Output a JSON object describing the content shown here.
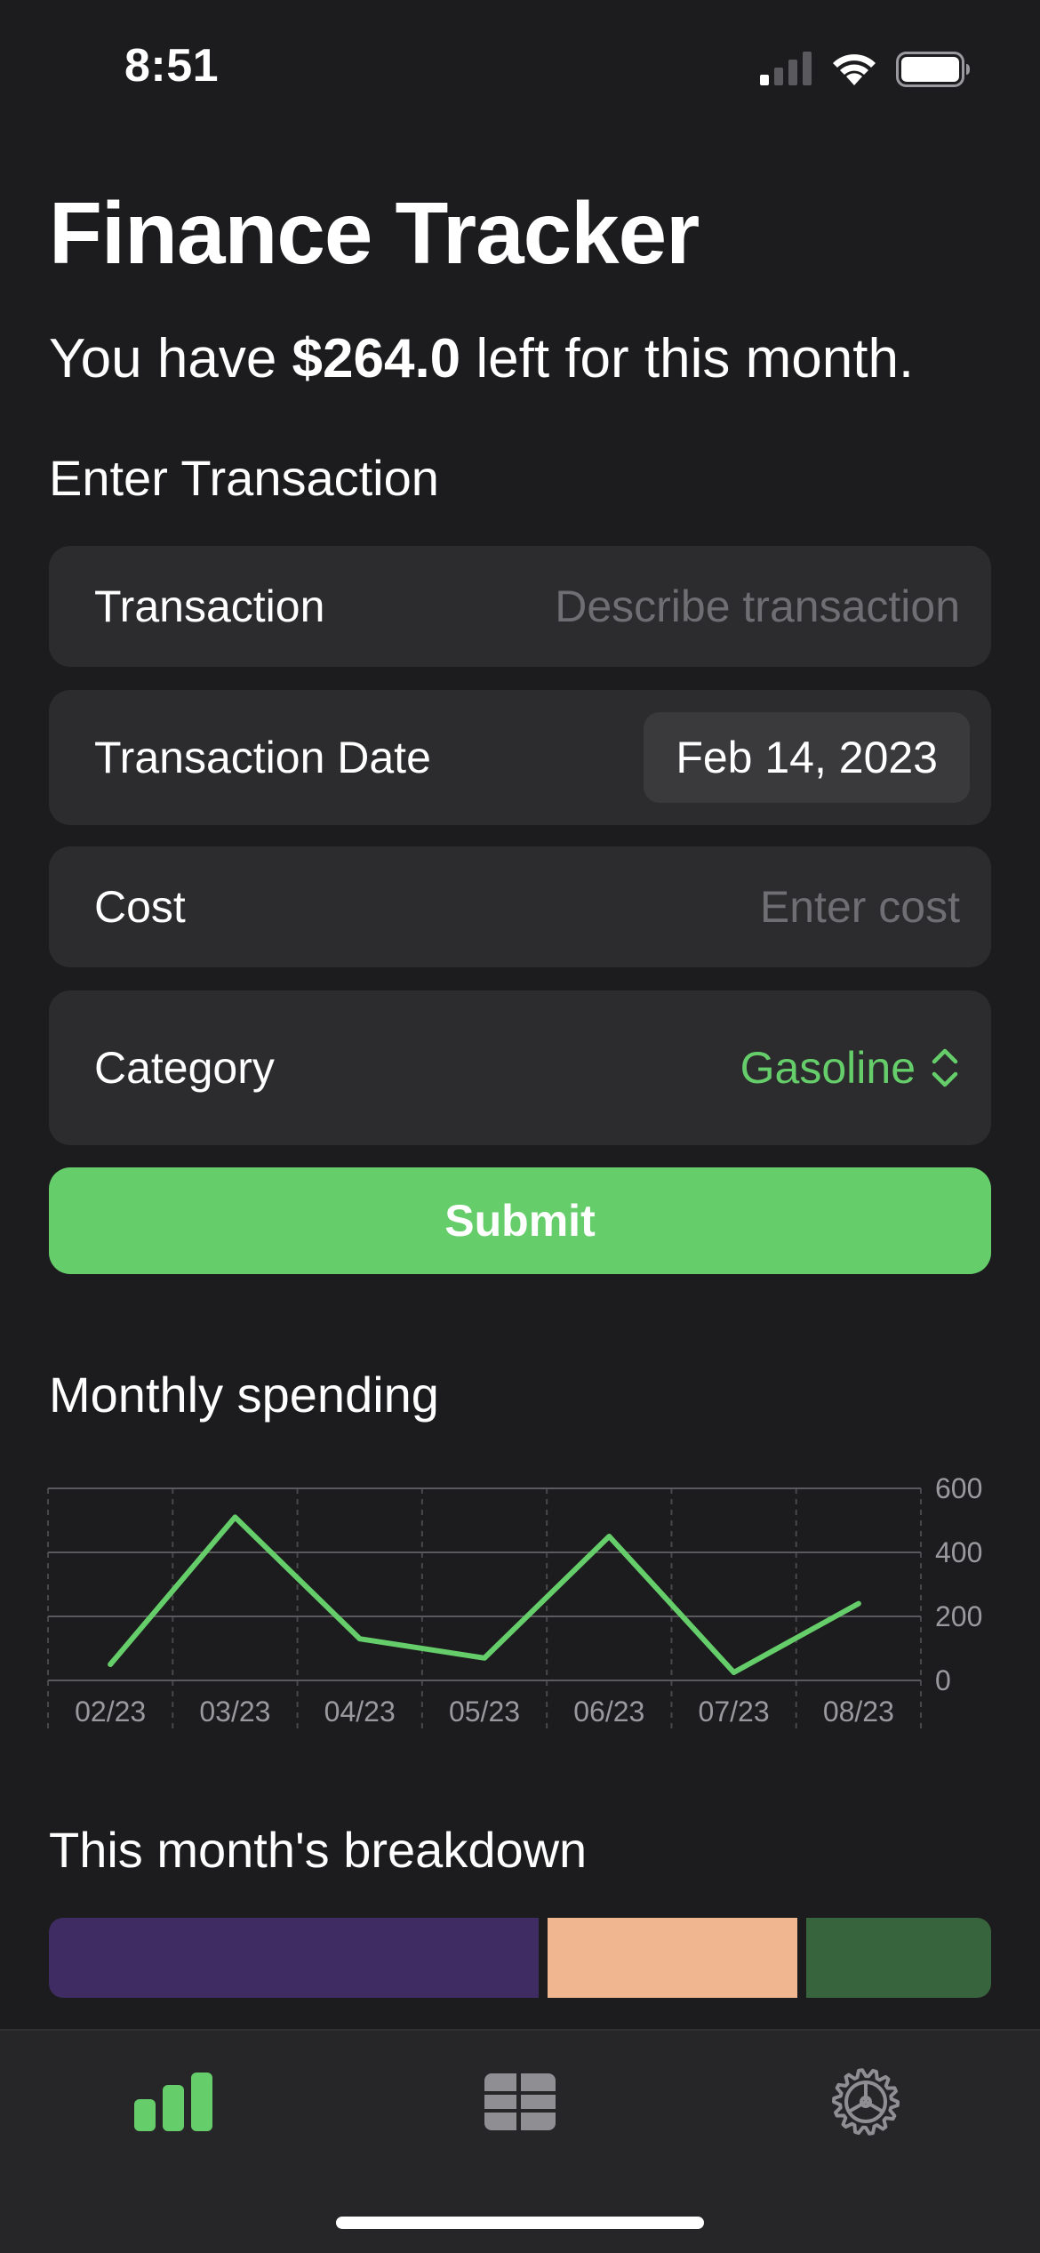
{
  "status_bar": {
    "time": "8:51",
    "icons": [
      "signal-icon",
      "wifi-icon",
      "battery-icon"
    ]
  },
  "header": {
    "title": "Finance Tracker",
    "budget_prefix": "You have ",
    "budget_amount": "$264.0",
    "budget_suffix": " left for this month."
  },
  "form": {
    "section_title": "Enter Transaction",
    "transaction": {
      "label": "Transaction",
      "placeholder": "Describe transaction",
      "value": ""
    },
    "date": {
      "label": "Transaction Date",
      "value": "Feb 14, 2023"
    },
    "cost": {
      "label": "Cost",
      "placeholder": "Enter cost",
      "value": ""
    },
    "category": {
      "label": "Category",
      "value": "Gasoline"
    },
    "submit_label": "Submit"
  },
  "spending": {
    "section_title": "Monthly spending"
  },
  "chart_data": {
    "type": "line",
    "title": "",
    "xlabel": "",
    "ylabel": "",
    "categories": [
      "02/23",
      "03/23",
      "04/23",
      "05/23",
      "06/23",
      "07/23",
      "08/23"
    ],
    "series": [
      {
        "values": [
          50,
          510,
          130,
          70,
          450,
          25,
          240
        ]
      }
    ],
    "ylim": [
      0,
      600
    ],
    "y_ticks": [
      0,
      200,
      400,
      600
    ],
    "y_axis_position": "right",
    "grid": true,
    "line_color": "#65ce6a"
  },
  "breakdown": {
    "section_title": "This month's breakdown",
    "segments": [
      {
        "fraction": 0.53,
        "color": "#3e2c63"
      },
      {
        "fraction": 0.27,
        "color": "#efb690"
      },
      {
        "fraction": 0.2,
        "color": "#37643c"
      }
    ]
  },
  "tab_bar": {
    "tabs": [
      {
        "icon": "bar-chart-icon",
        "active": true
      },
      {
        "icon": "table-icon",
        "active": false
      },
      {
        "icon": "settings-gear-icon",
        "active": false
      }
    ]
  },
  "colors": {
    "background": "#1c1c1e",
    "card": "#2c2c2e",
    "accent": "#65ce6a",
    "placeholder": "#6e6e73"
  }
}
